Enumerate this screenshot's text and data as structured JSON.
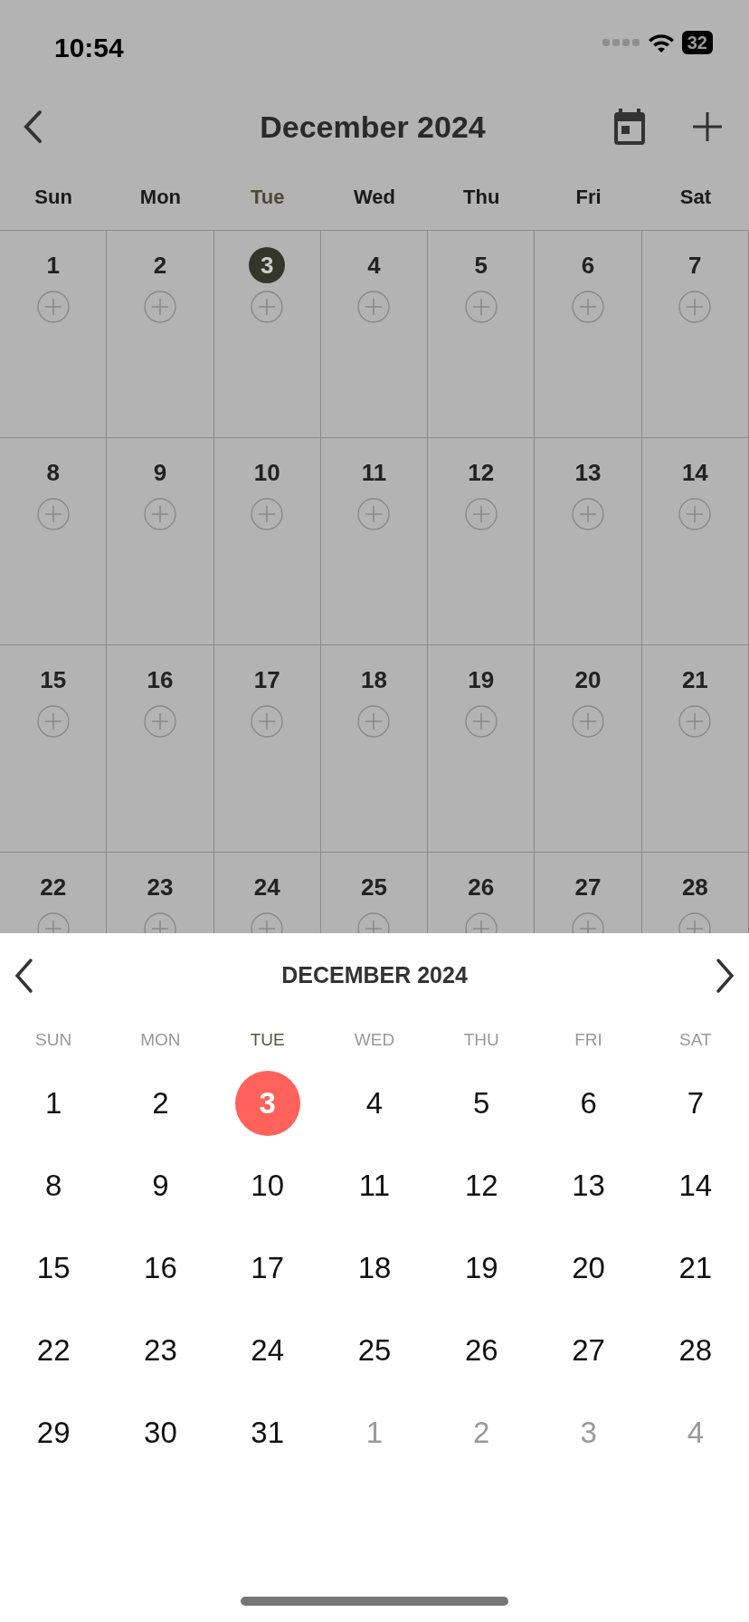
{
  "status_bar": {
    "time": "10:54",
    "battery": "32"
  },
  "header": {
    "title": "December 2024"
  },
  "weekdays": [
    {
      "label": "Sun",
      "selected": false
    },
    {
      "label": "Mon",
      "selected": false
    },
    {
      "label": "Tue",
      "selected": true
    },
    {
      "label": "Wed",
      "selected": false
    },
    {
      "label": "Thu",
      "selected": false
    },
    {
      "label": "Fri",
      "selected": false
    },
    {
      "label": "Sat",
      "selected": false
    }
  ],
  "weeks": [
    [
      {
        "label": "1",
        "selected": false
      },
      {
        "label": "2",
        "selected": false
      },
      {
        "label": "3",
        "selected": true
      },
      {
        "label": "4",
        "selected": false
      },
      {
        "label": "5",
        "selected": false
      },
      {
        "label": "6",
        "selected": false
      },
      {
        "label": "7",
        "selected": false
      }
    ],
    [
      {
        "label": "8",
        "selected": false
      },
      {
        "label": "9",
        "selected": false
      },
      {
        "label": "10",
        "selected": false
      },
      {
        "label": "11",
        "selected": false
      },
      {
        "label": "12",
        "selected": false
      },
      {
        "label": "13",
        "selected": false
      },
      {
        "label": "14",
        "selected": false
      }
    ],
    [
      {
        "label": "15",
        "selected": false
      },
      {
        "label": "16",
        "selected": false
      },
      {
        "label": "17",
        "selected": false
      },
      {
        "label": "18",
        "selected": false
      },
      {
        "label": "19",
        "selected": false
      },
      {
        "label": "20",
        "selected": false
      },
      {
        "label": "21",
        "selected": false
      }
    ],
    [
      {
        "label": "22",
        "selected": false
      },
      {
        "label": "23",
        "selected": false
      },
      {
        "label": "24",
        "selected": false
      },
      {
        "label": "25",
        "selected": false
      },
      {
        "label": "26",
        "selected": false
      },
      {
        "label": "27",
        "selected": false
      },
      {
        "label": "28",
        "selected": false
      }
    ]
  ],
  "picker": {
    "title": "DECEMBER 2024",
    "weekdays": [
      {
        "label": "SUN",
        "selected": false
      },
      {
        "label": "MON",
        "selected": false
      },
      {
        "label": "TUE",
        "selected": true
      },
      {
        "label": "WED",
        "selected": false
      },
      {
        "label": "THU",
        "selected": false
      },
      {
        "label": "FRI",
        "selected": false
      },
      {
        "label": "SAT",
        "selected": false
      }
    ],
    "days": [
      {
        "label": "1",
        "selected": false,
        "muted": false
      },
      {
        "label": "2",
        "selected": false,
        "muted": false
      },
      {
        "label": "3",
        "selected": true,
        "muted": false
      },
      {
        "label": "4",
        "selected": false,
        "muted": false
      },
      {
        "label": "5",
        "selected": false,
        "muted": false
      },
      {
        "label": "6",
        "selected": false,
        "muted": false
      },
      {
        "label": "7",
        "selected": false,
        "muted": false
      },
      {
        "label": "8",
        "selected": false,
        "muted": false
      },
      {
        "label": "9",
        "selected": false,
        "muted": false
      },
      {
        "label": "10",
        "selected": false,
        "muted": false
      },
      {
        "label": "11",
        "selected": false,
        "muted": false
      },
      {
        "label": "12",
        "selected": false,
        "muted": false
      },
      {
        "label": "13",
        "selected": false,
        "muted": false
      },
      {
        "label": "14",
        "selected": false,
        "muted": false
      },
      {
        "label": "15",
        "selected": false,
        "muted": false
      },
      {
        "label": "16",
        "selected": false,
        "muted": false
      },
      {
        "label": "17",
        "selected": false,
        "muted": false
      },
      {
        "label": "18",
        "selected": false,
        "muted": false
      },
      {
        "label": "19",
        "selected": false,
        "muted": false
      },
      {
        "label": "20",
        "selected": false,
        "muted": false
      },
      {
        "label": "21",
        "selected": false,
        "muted": false
      },
      {
        "label": "22",
        "selected": false,
        "muted": false
      },
      {
        "label": "23",
        "selected": false,
        "muted": false
      },
      {
        "label": "24",
        "selected": false,
        "muted": false
      },
      {
        "label": "25",
        "selected": false,
        "muted": false
      },
      {
        "label": "26",
        "selected": false,
        "muted": false
      },
      {
        "label": "27",
        "selected": false,
        "muted": false
      },
      {
        "label": "28",
        "selected": false,
        "muted": false
      },
      {
        "label": "29",
        "selected": false,
        "muted": false
      },
      {
        "label": "30",
        "selected": false,
        "muted": false
      },
      {
        "label": "31",
        "selected": false,
        "muted": false
      },
      {
        "label": "1",
        "selected": false,
        "muted": true
      },
      {
        "label": "2",
        "selected": false,
        "muted": true
      },
      {
        "label": "3",
        "selected": false,
        "muted": true
      },
      {
        "label": "4",
        "selected": false,
        "muted": true
      }
    ]
  }
}
